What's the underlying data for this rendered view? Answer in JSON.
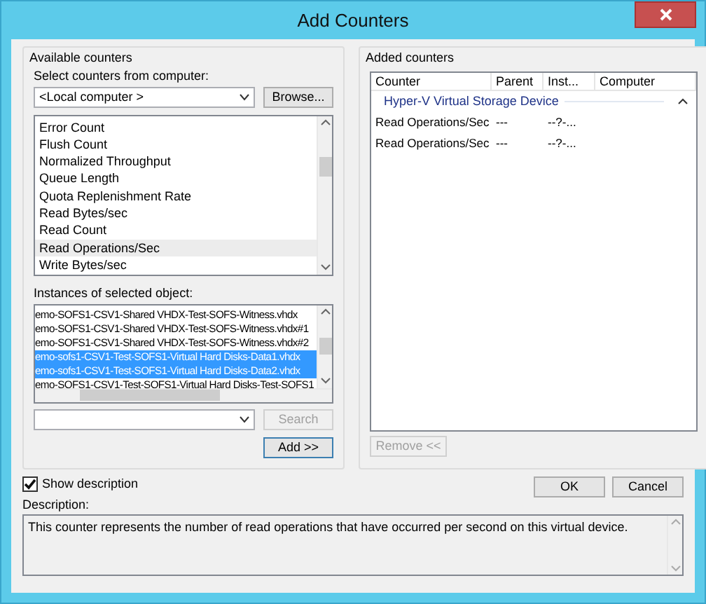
{
  "window": {
    "title": "Add Counters"
  },
  "available_counters": {
    "legend": "Available counters",
    "computer_label": "Select counters from computer:",
    "computer_value": "<Local computer >",
    "browse_button": "Browse...",
    "counters": [
      {
        "label": "Error Count",
        "selected": false
      },
      {
        "label": "Flush Count",
        "selected": false
      },
      {
        "label": "Normalized Throughput",
        "selected": false
      },
      {
        "label": "Queue Length",
        "selected": false
      },
      {
        "label": "Quota Replenishment Rate",
        "selected": false
      },
      {
        "label": "Read Bytes/sec",
        "selected": false
      },
      {
        "label": "Read Count",
        "selected": false
      },
      {
        "label": "Read Operations/Sec",
        "selected": true
      },
      {
        "label": "Write Bytes/sec",
        "selected": false
      }
    ],
    "instances_label": "Instances of selected object:",
    "instances": [
      {
        "label": "emo-SOFS1-CSV1-Shared VHDX-Test-SOFS-Witness.vhdx",
        "selected": false
      },
      {
        "label": "emo-SOFS1-CSV1-Shared VHDX-Test-SOFS-Witness.vhdx#1",
        "selected": false
      },
      {
        "label": "emo-SOFS1-CSV1-Shared VHDX-Test-SOFS-Witness.vhdx#2",
        "selected": false
      },
      {
        "label": "emo-sofs1-CSV1-Test-SOFS1-Virtual Hard Disks-Data1.vhdx",
        "selected": true
      },
      {
        "label": "emo-sofs1-CSV1-Test-SOFS1-Virtual Hard Disks-Data2.vhdx",
        "selected": true
      },
      {
        "label": "emo-SOFS1-CSV1-Test-SOFS1-Virtual Hard Disks-Test-SOFS1",
        "selected": false
      }
    ],
    "search_button": {
      "label": "Search",
      "disabled": true
    },
    "add_button": {
      "label": "Add >>",
      "disabled": false
    }
  },
  "added_counters": {
    "legend": "Added counters",
    "columns": [
      "Counter",
      "Parent",
      "Inst...",
      "Computer"
    ],
    "groups": [
      {
        "name": "Hyper-V Virtual Storage Device",
        "expanded": true,
        "rows": [
          [
            "Read Operations/Sec",
            "---",
            "--?-..."
          ],
          [
            "Read Operations/Sec",
            "---",
            "--?-..."
          ]
        ]
      }
    ],
    "remove_button": {
      "label": "Remove <<",
      "disabled": true
    }
  },
  "show_description": {
    "label": "Show description",
    "checked": true
  },
  "ok_button": "OK",
  "cancel_button": "Cancel",
  "description_label": "Description:",
  "description_text": "This counter represents the number of read operations that have occurred per second on this virtual device."
}
